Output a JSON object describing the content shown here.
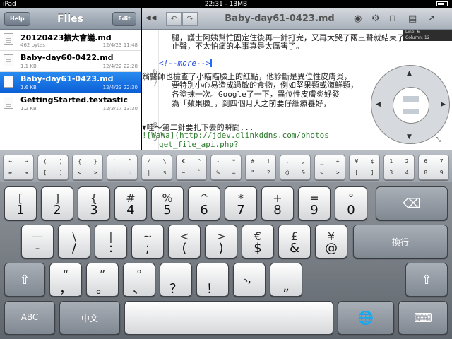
{
  "status": {
    "left": "iPad",
    "time": "22:31",
    "memory": "13MB"
  },
  "sidebar": {
    "title": "Files",
    "help_label": "Help",
    "edit_label": "Edit",
    "files": [
      {
        "name": "20120423擴大會議.md",
        "size": "462 bytes",
        "date": "12/4/23 11:48"
      },
      {
        "name": "Baby-day60-0422.md",
        "size": "1.1 KB",
        "date": "12/4/22 22:28"
      },
      {
        "name": "Baby-day61-0423.md",
        "size": "1.6 KB",
        "date": "12/4/23 22:30"
      },
      {
        "name": "GettingStarted.textastic",
        "size": "1.2 KB",
        "date": "12/3/17 13:30"
      }
    ]
  },
  "editor": {
    "title": "Baby-day61-0423.md",
    "line_label": "Line:",
    "line_value": "6",
    "column_label": "Column:",
    "column_value": "12",
    "line_numbers": [
      "6",
      "7",
      "8",
      "9"
    ],
    "lines": [
      "腿，護士阿姨幫忙固定住後再一針打完，又再大哭了兩三聲就結束了",
      "止聲，不太怕痛的本事真是太厲害了。",
      "<!--more-->",
      "翁醫師也檢查了小瞄瞄臉上的紅點，他診斷是異位性皮膚炎，",
      "要特別小心易造成過敏的食物，例如堅果類或海鮮類，",
      "各塗抹一次。Google了一下，異位性皮膚炎好發",
      "為「蘋果臉」，到四個月大之前要仔細療養好，",
      "▼哇～第二針要扎下去的瞬間...",
      "![WaWa](http://jdev.dlinkddns.com/photos",
      "get_file_api.php?"
    ]
  },
  "extra_keys": [
    {
      "top": "←  →",
      "bottom": "⇤  ⇥"
    },
    {
      "top": "(  )",
      "bottom": "[  ]"
    },
    {
      "top": "{  }",
      "bottom": "<  >"
    },
    {
      "top": "'  \"",
      "bottom": ";  :"
    },
    {
      "top": "/  \\",
      "bottom": "|  $"
    },
    {
      "top": "€  ^",
      "bottom": "~  `"
    },
    {
      "top": "-  *",
      "bottom": "%  ="
    },
    {
      "top": "#  !",
      "bottom": "\"  ?"
    },
    {
      "top": ".  ,",
      "bottom": "@  &"
    },
    {
      "top": "_  +",
      "bottom": "<  >"
    },
    {
      "top": "¥  ¢",
      "bottom": "[  ]"
    },
    {
      "top": "1  2",
      "bottom": "3  4"
    },
    {
      "top": "6  7",
      "bottom": "8  9"
    }
  ],
  "keyboard": {
    "row1": [
      {
        "up": "[",
        "dn": "1"
      },
      {
        "up": "]",
        "dn": "2"
      },
      {
        "up": "{",
        "dn": "3"
      },
      {
        "up": "#",
        "dn": "4"
      },
      {
        "up": "%",
        "dn": "5"
      },
      {
        "up": "^",
        "dn": "6"
      },
      {
        "up": "*",
        "dn": "7"
      },
      {
        "up": "+",
        "dn": "8"
      },
      {
        "up": "=",
        "dn": "9"
      },
      {
        "up": "°",
        "dn": "0"
      }
    ],
    "row2": [
      {
        "up": "—",
        "dn": "-"
      },
      {
        "up": "\\",
        "dn": "/"
      },
      {
        "up": "|",
        "dn": ":"
      },
      {
        "up": "~",
        "dn": ";"
      },
      {
        "up": "<",
        "dn": "("
      },
      {
        "up": ">",
        "dn": ")"
      },
      {
        "up": "€",
        "dn": "$"
      },
      {
        "up": "£",
        "dn": "&"
      },
      {
        "up": "¥",
        "dn": "@"
      }
    ],
    "row3": [
      {
        "up": "“",
        "dn": "，"
      },
      {
        "up": "”",
        "dn": "。"
      },
      {
        "up": "°",
        "dn": "、"
      },
      {
        "up": "",
        "dn": "？"
      },
      {
        "up": "",
        "dn": "！"
      },
      {
        "up": "、",
        "dn": "’"
      },
      {
        "up": "",
        "dn": "„"
      }
    ],
    "return_label": "換行",
    "abc_label": "ABC",
    "chinese_label": "中文"
  }
}
